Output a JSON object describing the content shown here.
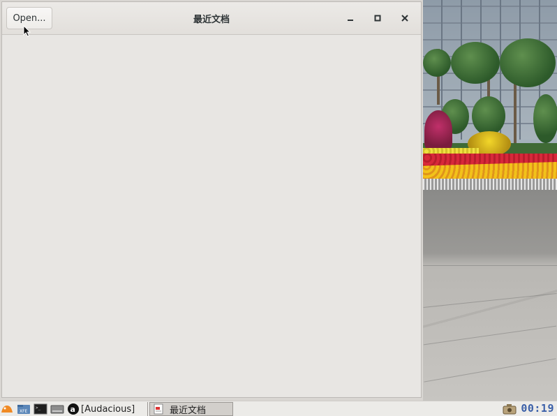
{
  "window": {
    "title": "最近文档",
    "open_button_label": "Open..."
  },
  "taskbar": {
    "tasks": [
      {
        "label": "[Audacious]"
      },
      {
        "label": "最近文档"
      }
    ],
    "clock": "00:19"
  },
  "icons": {
    "menu": "xfce-mouse-icon",
    "files": "file-manager-icon",
    "terminal": "terminal-icon",
    "drive": "drive-icon",
    "audacious": "audacious-icon",
    "document": "document-icon",
    "tray": "camera-tray-icon",
    "minimize": "minimize-icon",
    "maximize": "maximize-icon",
    "close": "close-icon"
  },
  "colors": {
    "clock": "#3a5fa8",
    "window_bg": "#e8e6e3"
  }
}
